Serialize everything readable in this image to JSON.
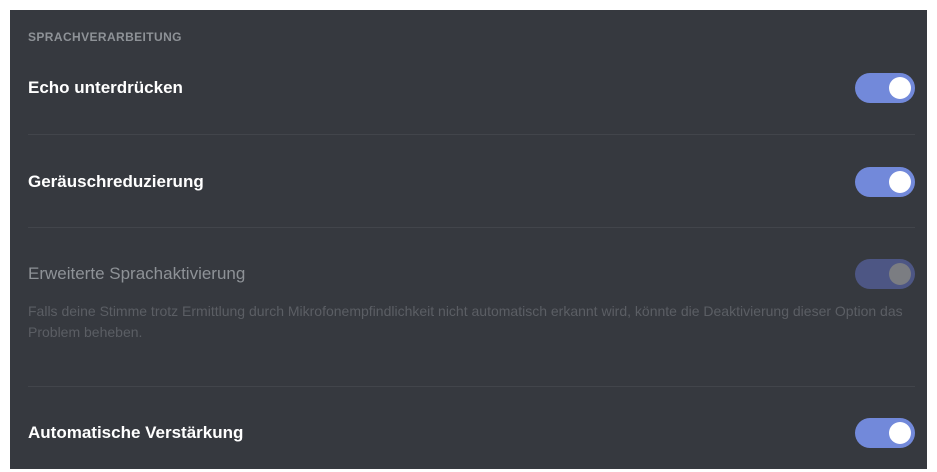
{
  "section": {
    "title": "SPRACHVERARBEITUNG"
  },
  "settings": [
    {
      "label": "Echo unterdrücken",
      "enabled": true,
      "disabled": false
    },
    {
      "label": "Geräuschreduzierung",
      "enabled": true,
      "disabled": false
    },
    {
      "label": "Erweiterte Sprachaktivierung",
      "description": "Falls deine Stimme trotz Ermittlung durch Mikrofonempfindlichkeit nicht automatisch erkannt wird, könnte die Deaktivierung dieser Option das Problem beheben.",
      "enabled": true,
      "disabled": true
    },
    {
      "label": "Automatische Verstärkung",
      "enabled": true,
      "disabled": false
    }
  ],
  "colors": {
    "background": "#36393f",
    "accent": "#7289da",
    "section_title": "#8e9297",
    "divider": "#42454b",
    "description": "#5b5e64"
  }
}
